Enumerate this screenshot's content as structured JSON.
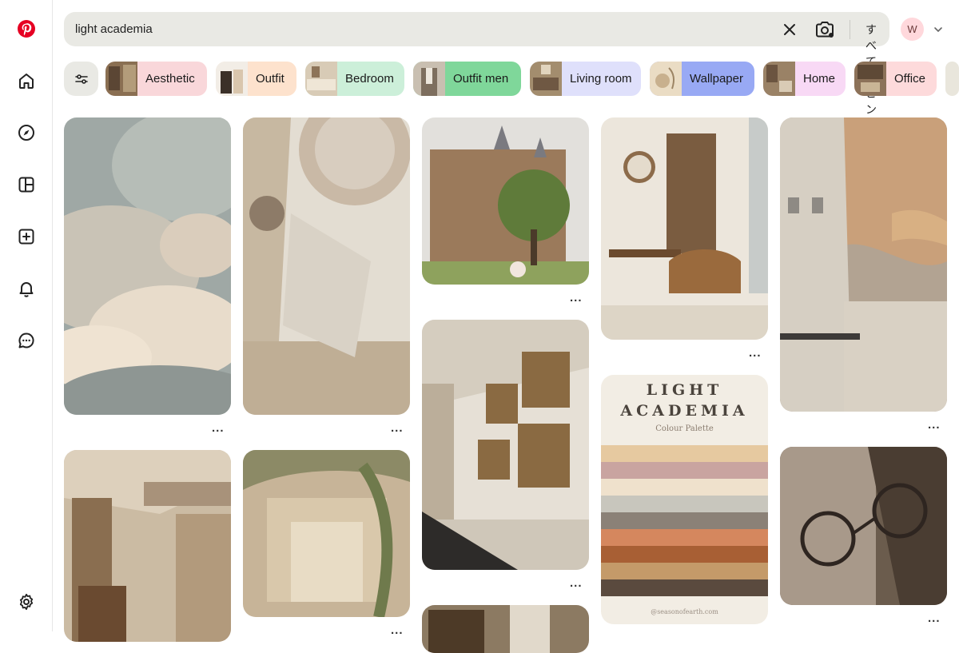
{
  "search": {
    "query": "light academia",
    "scope_label": "すべてのピン"
  },
  "account": {
    "avatar_letter": "W"
  },
  "filters": {
    "chips": [
      {
        "label": "Aesthetic",
        "color": "#f9d7da"
      },
      {
        "label": "Outfit",
        "color": "#fde2cd"
      },
      {
        "label": "Bedroom",
        "color": "#ccefd9"
      },
      {
        "label": "Outfit men",
        "color": "#7fd79a"
      },
      {
        "label": "Living room",
        "color": "#dfe0fb"
      },
      {
        "label": "Wallpaper",
        "color": "#98a9f4"
      },
      {
        "label": "Home",
        "color": "#f8d9f5"
      },
      {
        "label": "Office",
        "color": "#fddadb"
      }
    ]
  },
  "pins": [
    {
      "id": "clouds"
    },
    {
      "id": "baroque-ceiling"
    },
    {
      "id": "castle"
    },
    {
      "id": "study-room"
    },
    {
      "id": "paris-building"
    },
    {
      "id": "library"
    },
    {
      "id": "ivy-hall"
    },
    {
      "id": "gallery-hall"
    },
    {
      "id": "palette"
    },
    {
      "id": "glasses"
    },
    {
      "id": "painting-partial"
    }
  ],
  "palette_pin": {
    "title_line1": "LIGHT",
    "title_line2": "ACADEMIA",
    "subtitle": "Colour Palette",
    "credit": "@seasonofearth.com",
    "swatches": [
      "#e6c9a0",
      "#c9a4a0",
      "#efe1cc",
      "#c8c6bd",
      "#8b8177",
      "#d5875e",
      "#a85f34",
      "#c49a69",
      "#5a4a3e"
    ]
  },
  "more_label": "..."
}
